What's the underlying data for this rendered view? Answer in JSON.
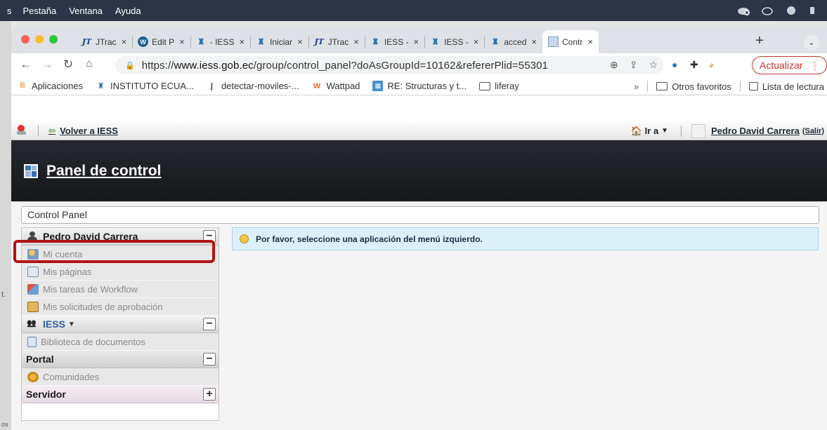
{
  "menubar": {
    "left_fragment": "s",
    "items": [
      "Pestaña",
      "Ventana",
      "Ayuda"
    ]
  },
  "desktop": {
    "frag1": "t.",
    "frag2": "os"
  },
  "tabs": [
    {
      "label": "JTrac",
      "icon": "jtrac-icon"
    },
    {
      "label": "Edit P",
      "icon": "wordpress-icon"
    },
    {
      "label": "- IESS",
      "icon": "iess-icon"
    },
    {
      "label": "Iniciar",
      "icon": "iess-icon"
    },
    {
      "label": "JTrac",
      "icon": "jtrac-icon"
    },
    {
      "label": "IESS -",
      "icon": "iess-icon"
    },
    {
      "label": "IESS -",
      "icon": "iess-icon"
    },
    {
      "label": "acced",
      "icon": "iess-icon"
    },
    {
      "label": "Contr",
      "icon": "liferay-icon",
      "active": true
    }
  ],
  "tab_close": "×",
  "address": {
    "scheme": "https://",
    "host": "www.iess.gob.ec",
    "path": "/group/control_panel?doAsGroupId=10162&refererPlid=55301"
  },
  "update_button": "Actualizar",
  "bookmarks": {
    "apps": "Aplicaciones",
    "items": [
      "INSTITUTO ECUA...",
      "detectar-moviles-...",
      "Wattpad",
      "RE: Structuras y t...",
      "liferay"
    ],
    "overflow": "»",
    "other": "Otros favoritos",
    "reading_list": "Lista de lectura"
  },
  "dock": {
    "back_link": "Volver a IESS",
    "goto": "Ir a",
    "user": "Pedro David Carrera",
    "signout": "(Salir)"
  },
  "control_panel": {
    "title": "Panel de control",
    "breadcrumb": "Control Panel",
    "info": "Por favor, seleccione una aplicación del menú izquierdo."
  },
  "sidebar": {
    "user_section": {
      "title": "Pedro David Carrera",
      "items": [
        "Mi cuenta",
        "Mis páginas",
        "Mis tareas de Workflow",
        "Mis solicitudes de aprobación"
      ]
    },
    "group_section": {
      "title": "IESS",
      "items": [
        "Biblioteca de documentos"
      ]
    },
    "portal_section": {
      "title": "Portal",
      "items": [
        "Comunidades"
      ]
    },
    "server_section": {
      "title": "Servidor"
    }
  },
  "colors": {
    "menubar": "#2b3546",
    "highlight": "#b11414",
    "info_bg": "#dcf0fa",
    "update": "#c5352c"
  }
}
